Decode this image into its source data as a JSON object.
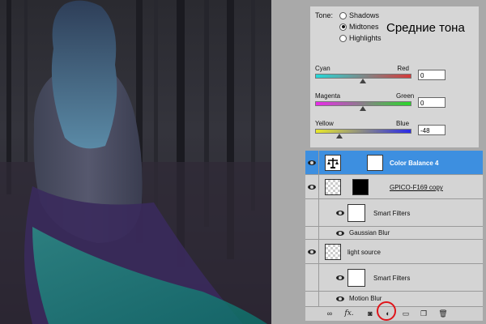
{
  "adjustments": {
    "tone_label": "Tone:",
    "tones": [
      {
        "label": "Shadows",
        "checked": false
      },
      {
        "label": "Midtones",
        "checked": true
      },
      {
        "label": "Highlights",
        "checked": false
      }
    ],
    "overlay_note": "Средние тона",
    "sliders": [
      {
        "left": "Cyan",
        "right": "Red",
        "value": "0",
        "level": 0
      },
      {
        "left": "Magenta",
        "right": "Green",
        "value": "0",
        "level": 0
      },
      {
        "left": "Yellow",
        "right": "Blue",
        "value": "-48",
        "level": -48
      }
    ]
  },
  "layers": {
    "items": [
      {
        "name": "Color Balance 4",
        "selected": true
      },
      {
        "name": "GPICO-F169 copy",
        "selected": false
      },
      {
        "name": "Smart Filters",
        "selected": false
      },
      {
        "name": "Gaussian Blur",
        "selected": false
      },
      {
        "name": "light source",
        "selected": false
      },
      {
        "name": "Smart Filters",
        "selected": false
      },
      {
        "name": "Motion Blur",
        "selected": false
      }
    ],
    "footer_icons": [
      "link-icon",
      "fx-icon",
      "mask-icon",
      "adjustment-layer-icon",
      "group-icon",
      "new-layer-icon",
      "trash-icon"
    ],
    "footer_fx": "fx."
  },
  "colors": {
    "selected_layer": "#3d8fe0",
    "highlight_circle": "#e0151b",
    "panel_bg": "#d6d6d6"
  }
}
